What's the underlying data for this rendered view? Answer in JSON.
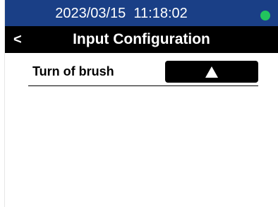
{
  "status_bar": {
    "datetime": "2023/03/15  11:18:02",
    "indicator_color": "#22c55e"
  },
  "header": {
    "back_label": "<",
    "title": "Input Configuration"
  },
  "settings": [
    {
      "label": "Turn of brush",
      "button_icon": "up-triangle-icon"
    }
  ],
  "colors": {
    "status_bar_bg": "#1a3f86",
    "title_bar_bg": "#000000",
    "button_bg": "#000000"
  }
}
